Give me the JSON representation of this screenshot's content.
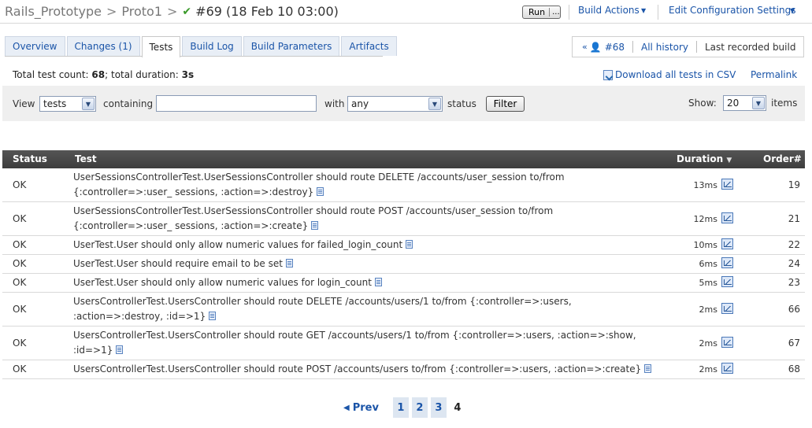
{
  "header": {
    "project": "Rails_Prototype",
    "sep1": ">",
    "config": "Proto1",
    "sep2": ">",
    "status_icon": "check-icon",
    "build_title": "#69 (18 Feb 10 03:00)",
    "run_label": "Run",
    "run_more": "...",
    "build_actions": "Build Actions",
    "edit_settings": "Edit Configuration Settings"
  },
  "tabs": [
    {
      "label": "Overview",
      "active": false
    },
    {
      "label": "Changes (1)",
      "active": false
    },
    {
      "label": "Tests",
      "active": true
    },
    {
      "label": "Build Log",
      "active": false
    },
    {
      "label": "Build Parameters",
      "active": false
    },
    {
      "label": "Artifacts",
      "active": false
    }
  ],
  "history": {
    "prev_arrows": "«",
    "prev_build": "#68",
    "all_history": "All history",
    "last_recorded": "Last recorded build"
  },
  "summary": {
    "prefix": "Total test count: ",
    "count": "68",
    "middle": "; total duration: ",
    "duration": "3s"
  },
  "links": {
    "download_csv": "Download all tests in CSV",
    "permalink": "Permalink"
  },
  "filter": {
    "view_label": "View",
    "view_value": "tests",
    "containing_label": "containing",
    "containing_value": "",
    "with_label": "with",
    "with_value": "any",
    "status_label": "status",
    "filter_button": "Filter",
    "show_label": "Show:",
    "show_value": "20",
    "items_label": "items"
  },
  "table": {
    "columns": {
      "status": "Status",
      "test": "Test",
      "duration": "Duration",
      "order": "Order#"
    },
    "sort_indicator": "▼",
    "rows": [
      {
        "status": "OK",
        "test": "UserSessionsControllerTest.UserSessionsController should route DELETE /accounts/user_session to/from {:controller=>:user_ sessions, :action=>:destroy}",
        "duration": "13ms",
        "order": "19"
      },
      {
        "status": "OK",
        "test": "UserSessionsControllerTest.UserSessionsController should route POST /accounts/user_session to/from {:controller=>:user_ sessions, :action=>:create}",
        "duration": "12ms",
        "order": "21"
      },
      {
        "status": "OK",
        "test": "UserTest.User should only allow numeric values for failed_login_count",
        "duration": "10ms",
        "order": "22"
      },
      {
        "status": "OK",
        "test": "UserTest.User should require email to be set",
        "duration": "6ms",
        "order": "24"
      },
      {
        "status": "OK",
        "test": "UserTest.User should only allow numeric values for login_count",
        "duration": "5ms",
        "order": "23"
      },
      {
        "status": "OK",
        "test": "UsersControllerTest.UsersController should route DELETE /accounts/users/1 to/from {:controller=>:users, :action=>:destroy, :id=>1}",
        "duration": "2ms",
        "order": "66"
      },
      {
        "status": "OK",
        "test": "UsersControllerTest.UsersController should route GET /accounts/users/1 to/from {:controller=>:users, :action=>:show, :id=>1}",
        "duration": "2ms",
        "order": "67"
      },
      {
        "status": "OK",
        "test": "UsersControllerTest.UsersController should route POST /accounts/users to/from {:controller=>:users, :action=>:create}",
        "duration": "2ms",
        "order": "68"
      }
    ]
  },
  "pager": {
    "prev_label": "Prev",
    "pages": [
      "1",
      "2",
      "3",
      "4"
    ],
    "current": "4"
  }
}
